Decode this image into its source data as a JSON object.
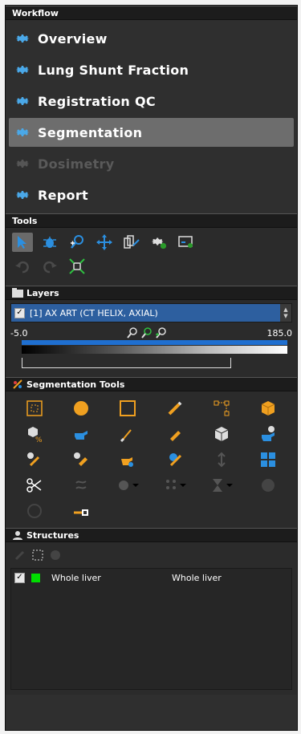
{
  "workflow": {
    "title": "Workflow",
    "items": [
      {
        "label": "Overview",
        "state": "normal"
      },
      {
        "label": "Lung Shunt Fraction",
        "state": "normal"
      },
      {
        "label": "Registration QC",
        "state": "normal"
      },
      {
        "label": "Segmentation",
        "state": "active"
      },
      {
        "label": "Dosimetry",
        "state": "disabled"
      },
      {
        "label": "Report",
        "state": "normal"
      }
    ]
  },
  "tools": {
    "title": "Tools",
    "icons": [
      "pointer-icon",
      "bug-icon",
      "zoom-plus-icon",
      "move-icon",
      "copy-icon",
      "gear-icon",
      "screenshot-icon",
      "undo-icon",
      "redo-icon",
      "fit-icon"
    ]
  },
  "layers": {
    "title": "Layers",
    "selected_layer": "[1] AX ART (CT HELIX, AXIAL)",
    "min": "-5.0",
    "max": "185.0"
  },
  "segmentation_tools": {
    "title": "Segmentation Tools"
  },
  "structures": {
    "title": "Structures",
    "rows": [
      {
        "name": "Whole liver",
        "type": "Whole liver",
        "color": "#00dd00"
      }
    ]
  },
  "colors": {
    "gear": "#4aa8e8",
    "active_bg": "#6d6d6d",
    "layer_bg": "#2d5f9f",
    "seg_orange": "#f0a020",
    "seg_blue": "#2b8fe0"
  }
}
